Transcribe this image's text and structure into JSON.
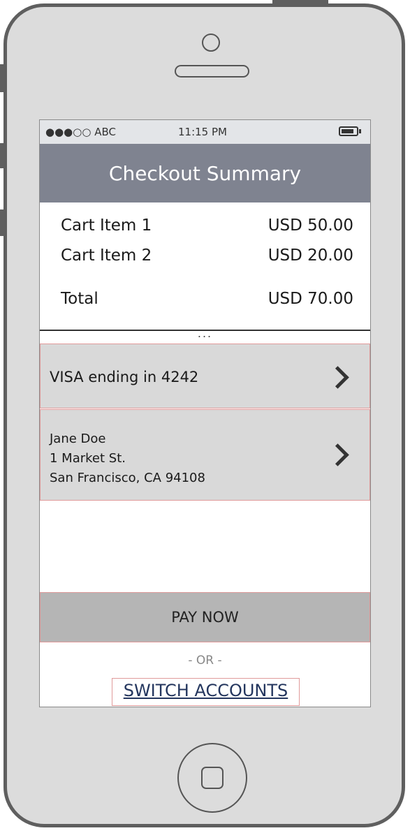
{
  "status_bar": {
    "carrier": "●●●○○ ABC",
    "time": "11:15 PM"
  },
  "header": {
    "title": "Checkout Summary"
  },
  "cart": {
    "items": [
      {
        "label": "Cart Item 1",
        "price": "USD 50.00"
      },
      {
        "label": "Cart Item 2",
        "price": "USD 20.00"
      }
    ],
    "total_label": "Total",
    "total_price": "USD 70.00"
  },
  "more_indicator": "...",
  "payment": {
    "label": "VISA ending in 4242"
  },
  "address": {
    "name": "Jane Doe",
    "street": "1 Market St.",
    "city": "San Francisco, CA 94108"
  },
  "actions": {
    "pay_label": "PAY NOW",
    "or_label": "- OR -",
    "switch_label": "SWITCH ACCOUNTS"
  },
  "colors": {
    "header_bg": "#7f8390",
    "card_bg": "#d9d9d9",
    "pay_bg": "#b5b5b5",
    "link": "#24365e"
  }
}
